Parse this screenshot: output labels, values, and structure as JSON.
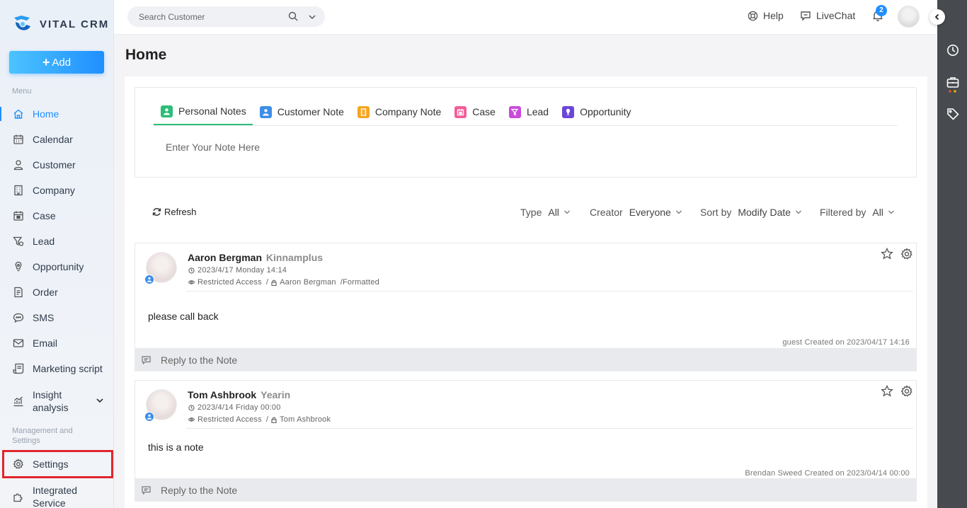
{
  "app": {
    "name": "VITAL CRM"
  },
  "sidebar": {
    "add_label": "Add",
    "menu_label": "Menu",
    "management_label": "Management and Settings",
    "items": [
      {
        "label": "Home",
        "icon": "home-icon"
      },
      {
        "label": "Calendar",
        "icon": "calendar-icon"
      },
      {
        "label": "Customer",
        "icon": "user-icon"
      },
      {
        "label": "Company",
        "icon": "building-icon"
      },
      {
        "label": "Case",
        "icon": "case-icon"
      },
      {
        "label": "Lead",
        "icon": "funnel-icon"
      },
      {
        "label": "Opportunity",
        "icon": "bulb-icon"
      },
      {
        "label": "Order",
        "icon": "order-icon"
      },
      {
        "label": "SMS",
        "icon": "chat-icon"
      },
      {
        "label": "Email",
        "icon": "mail-icon"
      },
      {
        "label": "Marketing script",
        "icon": "script-icon"
      },
      {
        "label": "Insight analysis",
        "icon": "chart-icon"
      }
    ],
    "management_items": [
      {
        "label": "Settings",
        "icon": "gear-icon"
      },
      {
        "label": "Integrated Service",
        "icon": "puzzle-icon"
      }
    ]
  },
  "header": {
    "search_placeholder": "Search Customer",
    "help_label": "Help",
    "livechat_label": "LiveChat",
    "notification_count": "2"
  },
  "main": {
    "title": "Home",
    "tabs": [
      {
        "label": "Personal Notes",
        "color": "#2dbd78"
      },
      {
        "label": "Customer Note",
        "color": "#3d8ee8"
      },
      {
        "label": "Company Note",
        "color": "#f5a623"
      },
      {
        "label": "Case",
        "color": "#f25f9a"
      },
      {
        "label": "Lead",
        "color": "#c94bd8"
      },
      {
        "label": "Opportunity",
        "color": "#6b46d9"
      }
    ],
    "note_placeholder": "Enter Your Note Here",
    "refresh_label": "Refresh",
    "filters": {
      "type_label": "Type",
      "type_value": "All",
      "creator_label": "Creator",
      "creator_value": "Everyone",
      "sort_label": "Sort by",
      "sort_value": "Modify Date",
      "filtered_label": "Filtered by",
      "filtered_value": "All"
    },
    "notes": [
      {
        "name": "Aaron Bergman",
        "company": "Kinnamplus",
        "datetime": "2023/4/17 Monday 14:14",
        "access": "Restricted Access",
        "owner": "Aaron Bergman",
        "format": "/Formatted",
        "content": "please call back",
        "created": "guest Created on 2023/04/17 14:16",
        "reply_label": "Reply to the Note"
      },
      {
        "name": "Tom Ashbrook",
        "company": "Yearin",
        "datetime": "2023/4/14 Friday 00:00",
        "access": "Restricted Access",
        "owner": "Tom Ashbrook",
        "format": "",
        "content": "this is a note",
        "created": "Brendan Sweed Created on 2023/04/14 00:00",
        "reply_label": "Reply to the Note"
      }
    ]
  },
  "colors": {
    "accent": "#1f8fff",
    "active_tab": "#2dbd78",
    "highlight": "#e0262f",
    "rail": "#474a4f"
  }
}
